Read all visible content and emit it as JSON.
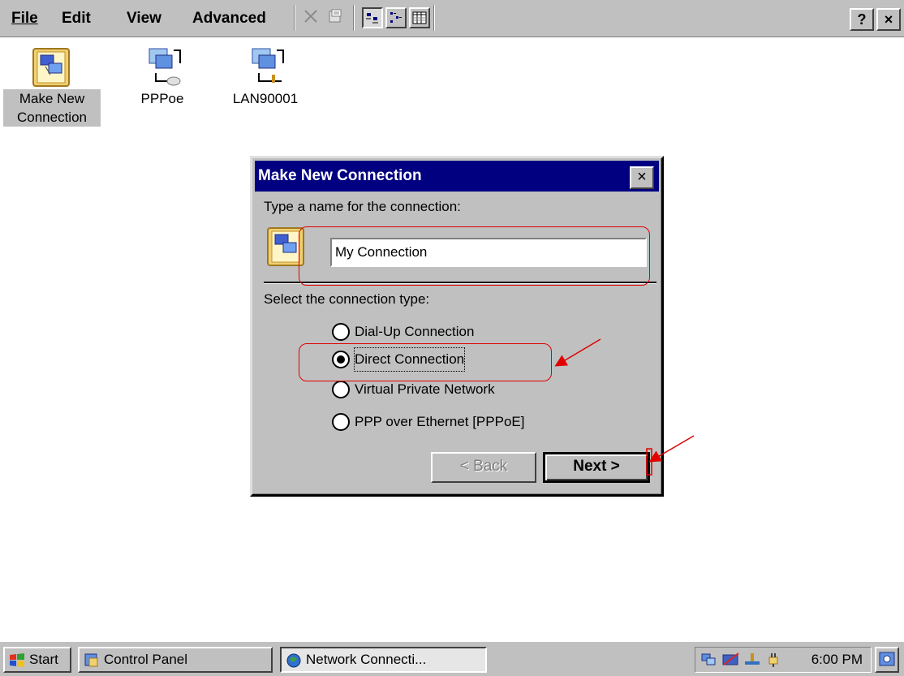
{
  "menubar": {
    "items": [
      "File",
      "Edit",
      "View",
      "Advanced"
    ],
    "toolbar_icons": [
      "delete-icon",
      "properties-icon",
      "large-icons-view-icon",
      "small-icons-view-icon",
      "details-view-icon"
    ],
    "help_label": "?",
    "close_label": "×"
  },
  "desktop": {
    "icons": [
      {
        "label_line1": "Make New",
        "label_line2": "Connection",
        "icon": "make-new-connection-icon",
        "selected": true
      },
      {
        "label_line1": "PPPoe",
        "label_line2": "",
        "icon": "network-connection-icon",
        "selected": false
      },
      {
        "label_line1": "LAN90001",
        "label_line2": "",
        "icon": "lan-connection-icon",
        "selected": false
      }
    ]
  },
  "dialog": {
    "title": "Make New Connection",
    "close_label": "×",
    "name_prompt": "Type a name for the connection:",
    "name_value": "My Connection",
    "type_prompt": "Select the connection type:",
    "options": [
      {
        "label": "Dial-Up Connection",
        "selected": false
      },
      {
        "label": "Direct Connection",
        "selected": true
      },
      {
        "label": "Virtual Private Network",
        "selected": false
      },
      {
        "label": "PPP over Ethernet [PPPoE]",
        "selected": false
      }
    ],
    "back_label": "< Back",
    "next_label": "Next >"
  },
  "taskbar": {
    "start_label": "Start",
    "tasks": [
      {
        "label": "Control Panel",
        "active": false
      },
      {
        "label": "Network Connecti...",
        "active": true
      }
    ],
    "clock": "6:00 PM"
  },
  "colors": {
    "title_bar": "#000080",
    "face": "#c0c0c0",
    "annotation": "#e00000"
  }
}
